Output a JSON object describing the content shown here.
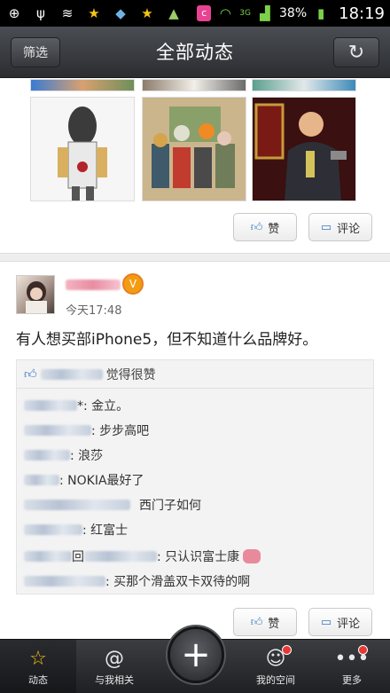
{
  "status_bar": {
    "battery": "38%",
    "time": "18:19",
    "network": "3G",
    "icons_left": [
      "add-icon",
      "usb-icon",
      "layers-icon",
      "star-icon",
      "pin-icon",
      "star-icon",
      "android-icon"
    ],
    "icons_right": [
      "notification-app-icon",
      "wifi-icon",
      "signal-icon",
      "battery-icon"
    ]
  },
  "title_bar": {
    "filter_label": "筛选",
    "title": "全部动态",
    "refresh_icon": "refresh-icon"
  },
  "feed": {
    "prev_post": {
      "like_label": "赞",
      "comment_label": "评论"
    },
    "post": {
      "time": "今天17:48",
      "text": "有人想买部iPhone5，但不知道什么品牌好。",
      "likes_suffix": "觉得很赞",
      "comments": [
        {
          "text": "*: 金立。"
        },
        {
          "text": ": 步步高吧"
        },
        {
          "text": ": 浪莎"
        },
        {
          "text": ": NOKIA最好了"
        },
        {
          "text": "西门子如何"
        },
        {
          "text": ": 红富士"
        },
        {
          "text": "回",
          "text2": ": 只认识富士康"
        },
        {
          "text": ": 买那个滑盖双卡双待的啊"
        }
      ],
      "like_label": "赞",
      "comment_label": "评论"
    }
  },
  "bottom_nav": {
    "items": [
      {
        "label": "动态",
        "icon": "star-icon"
      },
      {
        "label": "与我相关",
        "icon": "at-icon"
      },
      {
        "label": "我的空间",
        "icon": "profile-icon"
      },
      {
        "label": "更多",
        "icon": "more-icon"
      }
    ],
    "compose_icon": "plus-icon"
  },
  "colors": {
    "accent": "#f39c12",
    "title_bar": "#3a3c40",
    "notification_dot": "#e53935"
  }
}
